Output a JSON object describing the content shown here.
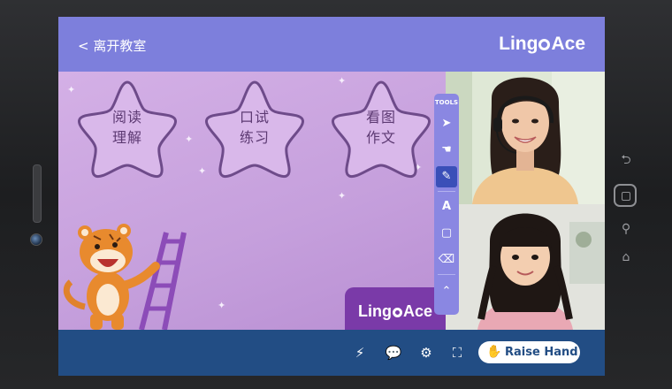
{
  "header": {
    "leave_label": "< 离开教室",
    "logo_left": "Ling",
    "logo_right": "Ace"
  },
  "board": {
    "cards": [
      {
        "line1": "阅读",
        "line2": "理解"
      },
      {
        "line1": "口试",
        "line2": "练习"
      },
      {
        "line1": "看图",
        "line2": "作文"
      }
    ],
    "watermark_left": "Ling",
    "watermark_right": "Ace"
  },
  "tools": {
    "title": "TOOLS",
    "items": [
      "pointer-icon",
      "hand-icon",
      "pen-icon",
      "text-icon",
      "shape-icon",
      "eraser-icon",
      "collapse-icon"
    ],
    "active": "pen-icon"
  },
  "bottom_bar": {
    "icons": [
      "lightning-icon",
      "chat-icon",
      "settings-icon",
      "fullscreen-icon"
    ],
    "raise_hand_label": "Raise Hand"
  },
  "colors": {
    "header": "#7d7fdc",
    "board": "#c9a6dc",
    "bottom_bar": "#224d84",
    "brand_purple": "#7a3aa8",
    "tools_panel": "#8a87e2",
    "tool_active": "#3a4fb8"
  }
}
